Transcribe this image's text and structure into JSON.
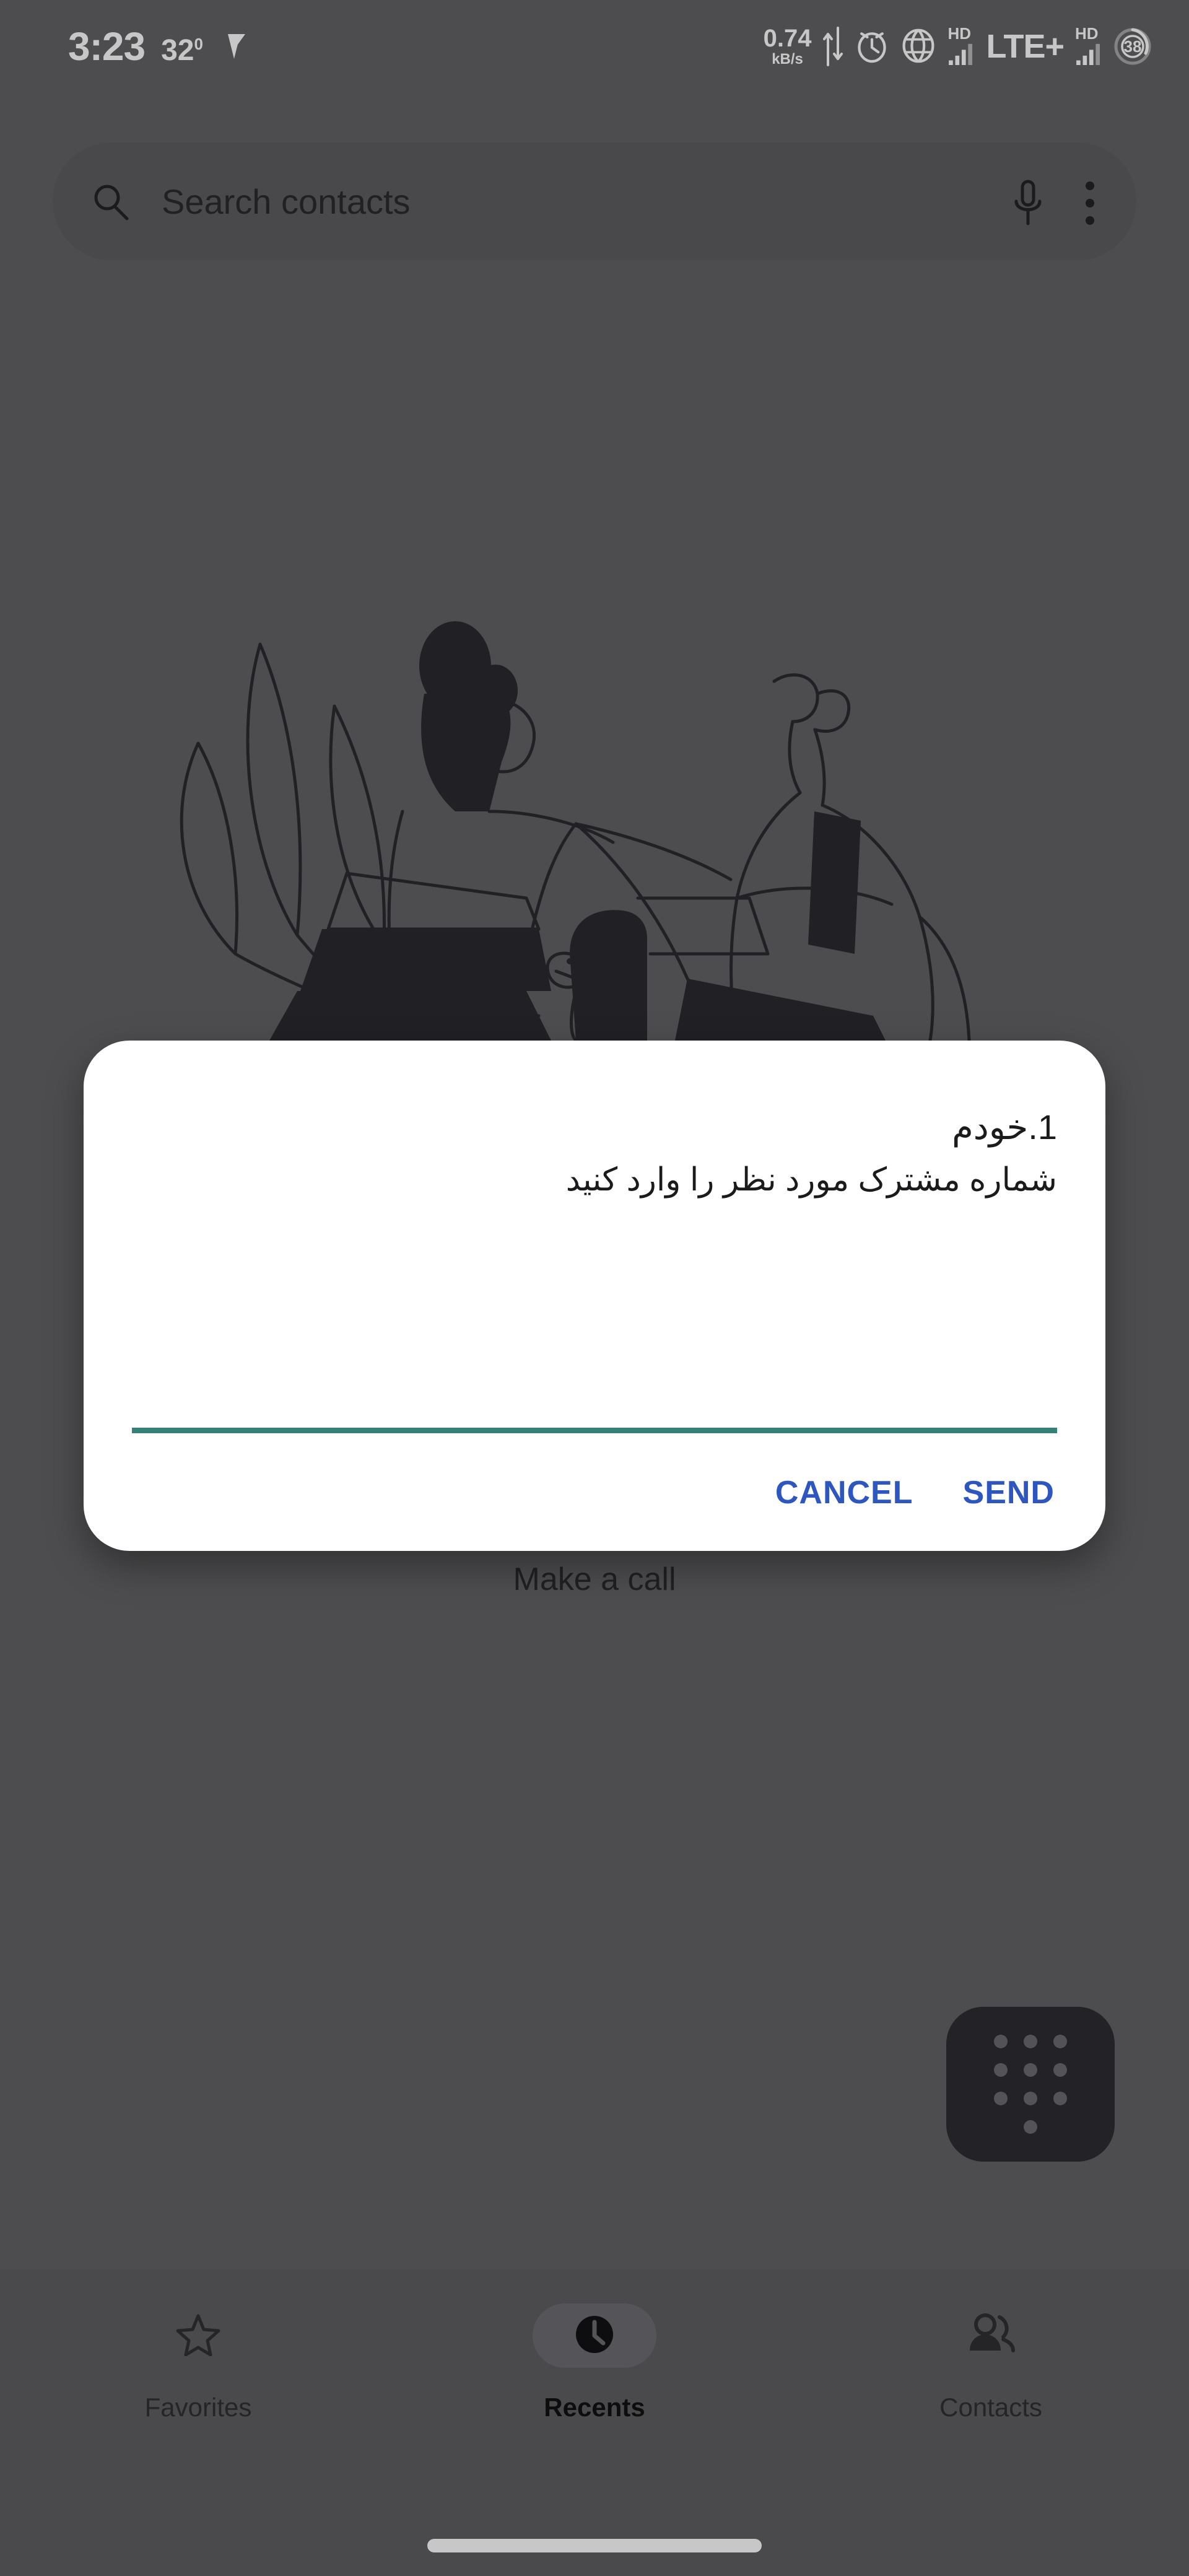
{
  "status_bar": {
    "time": "3:23",
    "temperature": "32",
    "temperature_unit": "0",
    "vpn_icon": "vpn-key-icon",
    "network_speed_value": "0.74",
    "network_speed_unit": "kB/s",
    "transfer_icon": "up-down-arrows-icon",
    "alarm_icon": "alarm-clock-icon",
    "globe_icon": "globe-icon",
    "sim1_hd_label": "HD",
    "sim1_signal_icon": "signal-bars-icon",
    "network_type": "LTE+",
    "sim2_hd_label": "HD",
    "sim2_signal_icon": "signal-bars-icon",
    "battery_level": "38",
    "battery_icon": "battery-circle-icon"
  },
  "search": {
    "placeholder": "Search contacts",
    "search_icon": "search-icon",
    "voice_icon": "microphone-icon",
    "overflow_icon": "more-vert-icon"
  },
  "empty_state": {
    "illustration_name": "people-with-dog-illustration",
    "caption": "Make a call"
  },
  "fab": {
    "name": "dialpad-fab",
    "icon": "dialpad-icon"
  },
  "dialog": {
    "title": "1.خودم",
    "message": "شماره مشترک مورد نظر را وارد کنید",
    "input_value": "",
    "input_placeholder": "",
    "underline_color": "#35817A",
    "cancel_label": "CANCEL",
    "send_label": "SEND",
    "button_color": "#2E56C0"
  },
  "bottom_nav": {
    "items": [
      {
        "label": "Favorites",
        "icon": "star-outline-icon",
        "active": false
      },
      {
        "label": "Recents",
        "icon": "clock-filled-icon",
        "active": true
      },
      {
        "label": "Contacts",
        "icon": "people-icon",
        "active": false
      }
    ]
  },
  "system": {
    "home_indicator": "home-indicator-bar"
  },
  "colors": {
    "background": "#636265",
    "search_fill": "#5E5D60",
    "nav_fill": "#5F5E62",
    "fab_fill": "#2E2E33",
    "dialog_fill": "#ffffff",
    "accent_teal": "#35817A",
    "accent_blue": "#2E56C0"
  }
}
